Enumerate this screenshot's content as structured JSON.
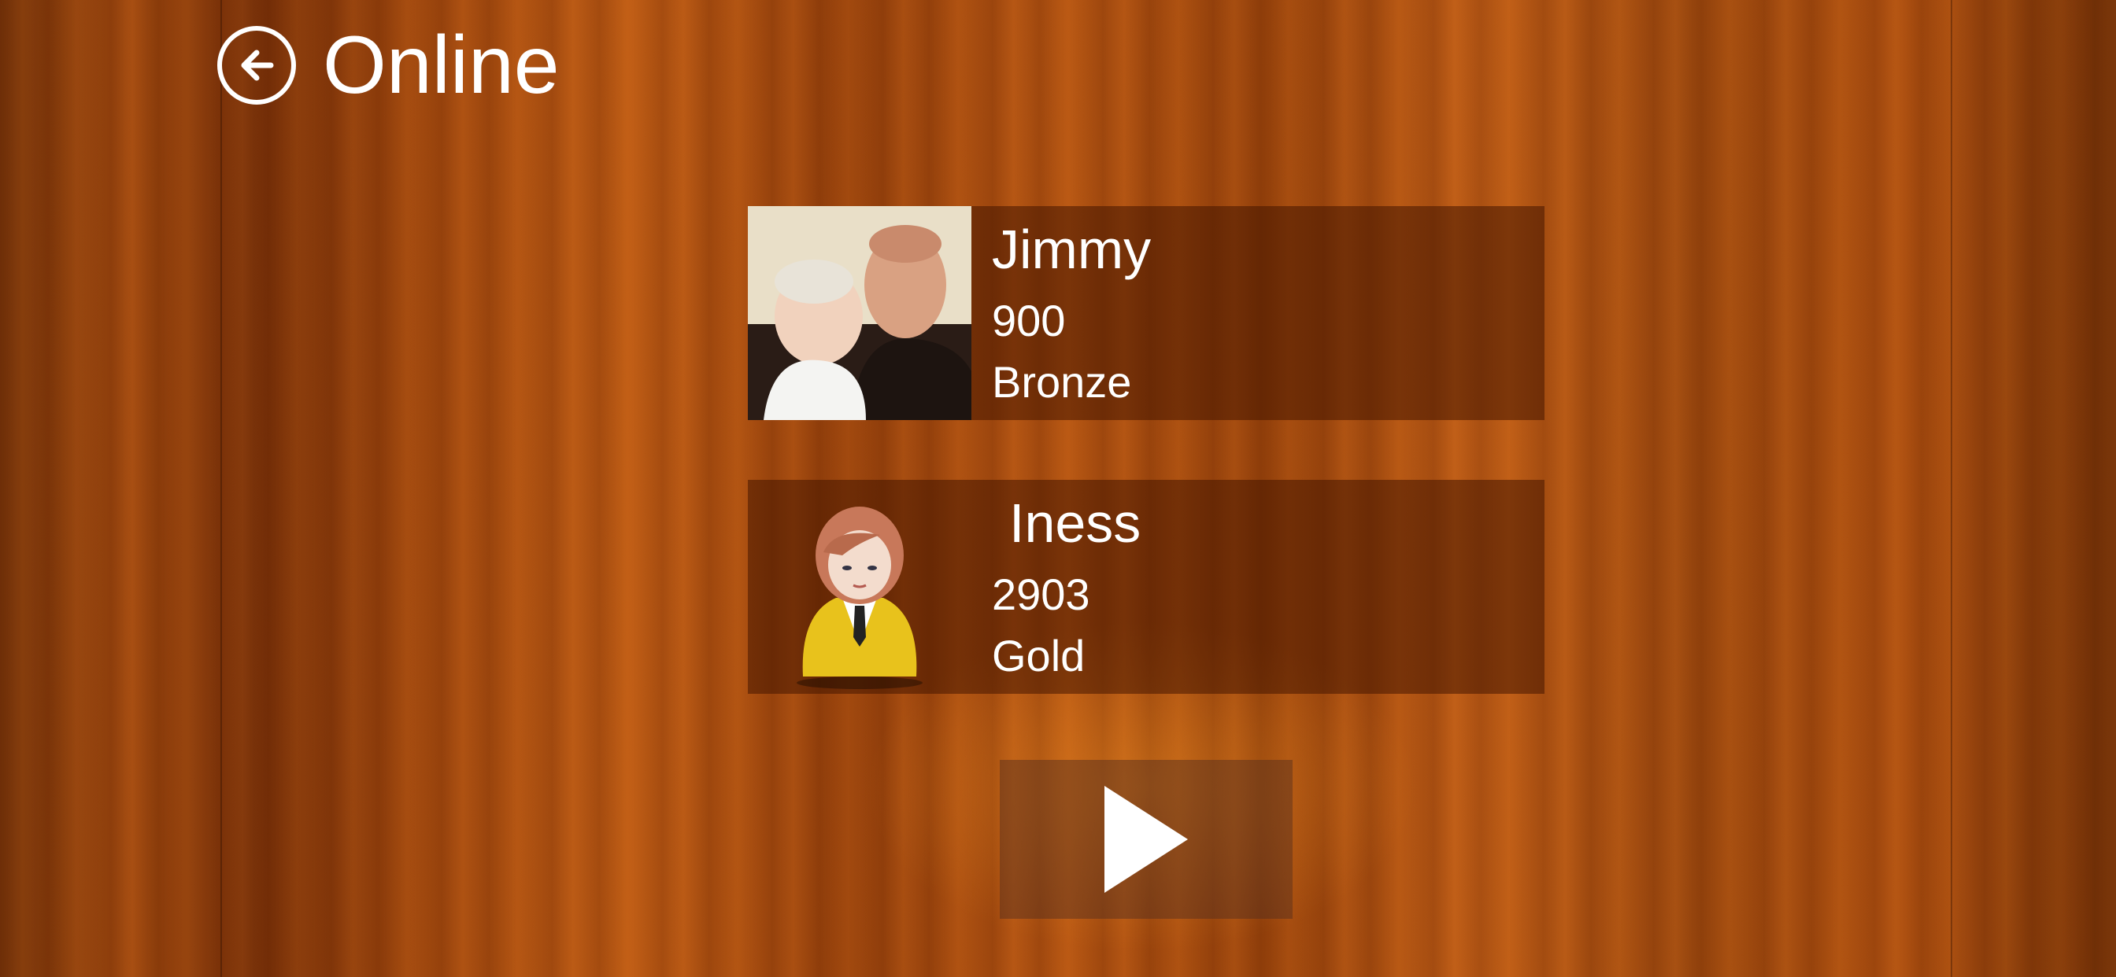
{
  "header": {
    "title": "Online",
    "back_icon": "back-arrow-circle-icon"
  },
  "players": [
    {
      "name": "Jimmy",
      "score": "900",
      "rank": "Bronze",
      "avatar": "photo-avatar"
    },
    {
      "name": "Iness",
      "score": "2903",
      "rank": "Gold",
      "avatar": "businesswoman-avatar-icon"
    }
  ],
  "play_button": {
    "icon": "play-icon"
  },
  "colors": {
    "card_bg": "#46160099",
    "text": "#ffffff",
    "wood": "#b05010"
  }
}
